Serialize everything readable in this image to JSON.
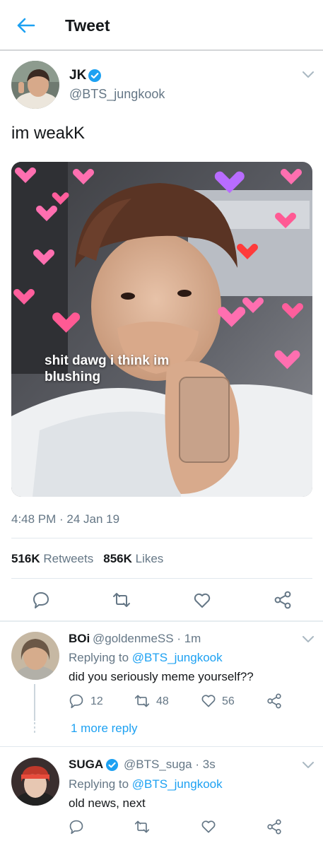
{
  "header": {
    "title": "Tweet",
    "back_icon": "arrow-left-icon"
  },
  "tweet": {
    "author_name": "JK",
    "author_handle": "@BTS_jungkook",
    "text": "im weakK",
    "media_caption": "shit dawg i think im blushing",
    "timestamp": "4:48 PM · 24 Jan 19",
    "retweets_count": "516K",
    "retweets_label": "Retweets",
    "likes_count": "856K",
    "likes_label": "Likes"
  },
  "replies": [
    {
      "name": "BOi",
      "handle": "@goldenmeSS",
      "time": "· 1m",
      "replying_label": "Replying to",
      "replying_to": "@BTS_jungkook",
      "text": "did you seriously meme yourself??",
      "reply_count": "12",
      "retweet_count": "48",
      "like_count": "56",
      "more_replies": "1 more reply"
    },
    {
      "name": "SUGA",
      "handle": "@BTS_suga",
      "time": "· 3s",
      "replying_label": "Replying to",
      "replying_to": "@BTS_jungkook",
      "text": "old news, next"
    }
  ],
  "colors": {
    "accent": "#1da1f2",
    "secondary_text": "#657786",
    "divider": "#e1e8ed"
  }
}
